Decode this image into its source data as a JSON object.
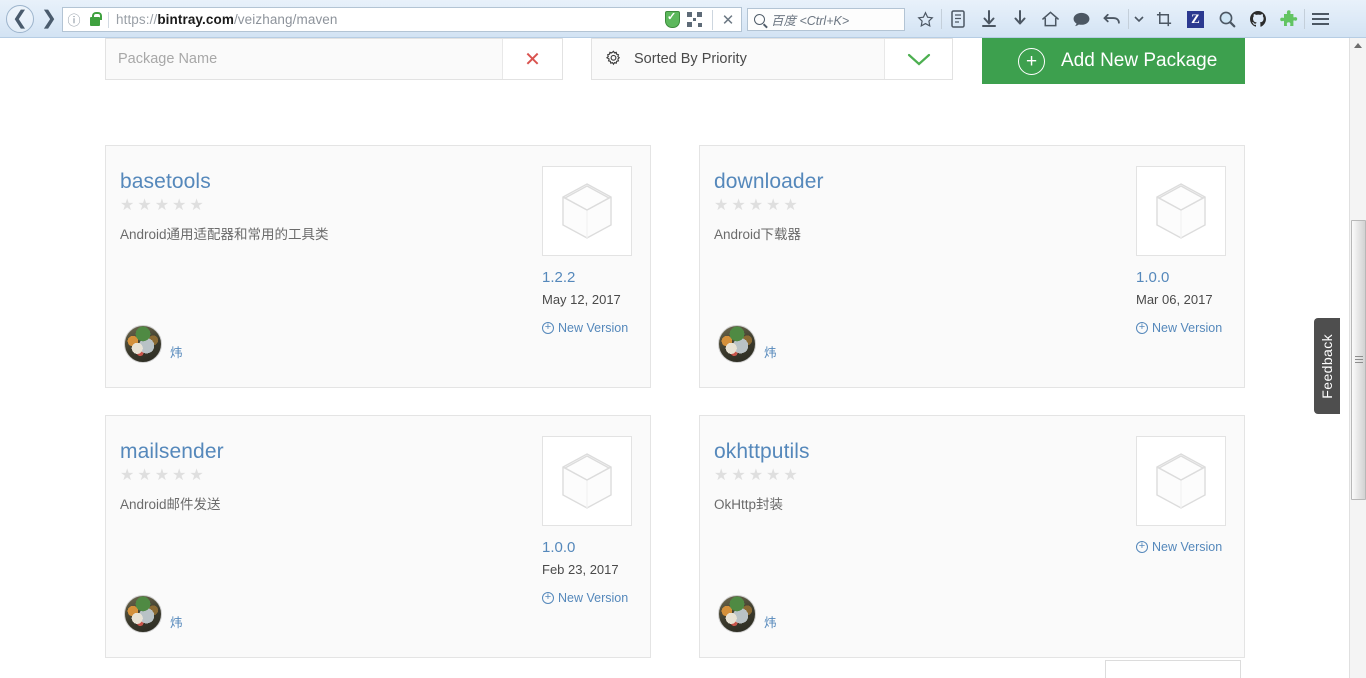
{
  "browser": {
    "back_label": "Back",
    "forward_label": "Forward",
    "url_prefix": "https://",
    "url_domain": "bintray.com",
    "url_path": "/veizhang/maven",
    "search_placeholder": "百度 <Ctrl+K>",
    "icons": {
      "info": "info-icon",
      "lock": "lock-icon",
      "shield": "shield-check-icon",
      "qr": "qr-code-icon",
      "close": "close-icon",
      "search": "search-icon",
      "bookmark": "star-icon",
      "library": "library-icon",
      "downloads": "download-arrow-icon",
      "home": "home-icon",
      "chat": "chat-bubble-icon",
      "undo": "undo-arrow-icon",
      "undo_dropdown": "chevron-down-icon",
      "crop": "crop-icon",
      "zotero": "Z",
      "magnifier": "magnifier-icon",
      "github": "github-octocat-icon",
      "puzzle": "puzzle-piece-icon",
      "menu": "hamburger-menu-icon"
    }
  },
  "toolbar": {
    "search_placeholder": "Package Name",
    "search_value": "",
    "clear_label": "✕",
    "sort_label": "Sorted By Priority",
    "sort_chevron": "⌄",
    "add_package_label": "Add New Package",
    "add_package_plus": "+",
    "accent_green": "#3da04e",
    "clear_red": "#d9534f"
  },
  "cards": [
    {
      "name": "basetools",
      "stars": 5,
      "description": "Android通用适配器和常用的工具类",
      "version": "1.2.2",
      "date": "May 12, 2017",
      "new_version_label": "New Version",
      "owner": "炜"
    },
    {
      "name": "downloader",
      "stars": 5,
      "description": "Android下载器",
      "version": "1.0.0",
      "date": "Mar 06, 2017",
      "new_version_label": "New Version",
      "owner": "炜"
    },
    {
      "name": "mailsender",
      "stars": 5,
      "description": "Android邮件发送",
      "version": "1.0.0",
      "date": "Feb 23, 2017",
      "new_version_label": "New Version",
      "owner": "炜"
    },
    {
      "name": "okhttputils",
      "stars": 5,
      "description": "OkHttp封装",
      "version": "",
      "date": "",
      "new_version_label": "New Version",
      "owner": "炜"
    }
  ],
  "feedback": {
    "label": "Feedback"
  },
  "colors": {
    "link_blue": "#5588bb",
    "card_bg": "#fafafa",
    "card_border": "#e4e4e4",
    "star_gray": "#dfdfdf"
  }
}
